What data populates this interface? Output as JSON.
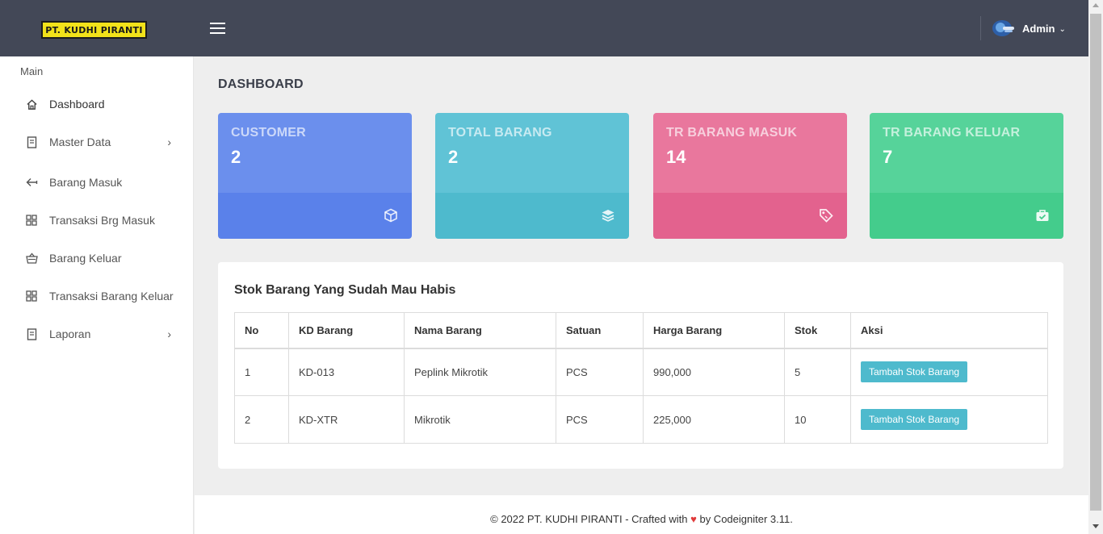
{
  "header": {
    "logo_text": "PT. KUDHI PIRANTI",
    "user_label": "Admin",
    "caret": "⌄"
  },
  "sidebar": {
    "section_label": "Main",
    "items": [
      {
        "label": "Dashboard",
        "icon": "home-icon"
      },
      {
        "label": "Master Data",
        "icon": "document-icon",
        "submenu": true
      },
      {
        "label": "Barang Masuk",
        "icon": "arrow-left-icon"
      },
      {
        "label": "Transaksi Brg Masuk",
        "icon": "grid-icon"
      },
      {
        "label": "Barang Keluar",
        "icon": "basket-icon"
      },
      {
        "label": "Transaksi Barang Keluar",
        "icon": "grid-icon"
      },
      {
        "label": "Laporan",
        "icon": "document-icon",
        "submenu": true
      }
    ],
    "chevron": "›"
  },
  "page": {
    "title": "DASHBOARD"
  },
  "cards": [
    {
      "title": "CUSTOMER",
      "value": "2",
      "icon": "cube-icon",
      "color": "#6b8fed"
    },
    {
      "title": "TOTAL BARANG",
      "value": "2",
      "icon": "layers-icon",
      "color": "#60c3d6"
    },
    {
      "title": "TR BARANG MASUK",
      "value": "14",
      "icon": "tag-icon",
      "color": "#e9779d"
    },
    {
      "title": "TR BARANG KELUAR",
      "value": "7",
      "icon": "briefcase-check-icon",
      "color": "#56d39a"
    }
  ],
  "stock_panel": {
    "title": "Stok Barang Yang Sudah Mau Habis",
    "columns": [
      "No",
      "KD Barang",
      "Nama Barang",
      "Satuan",
      "Harga Barang",
      "Stok",
      "Aksi"
    ],
    "rows": [
      {
        "no": "1",
        "kd": "KD-013",
        "nama": "Peplink Mikrotik",
        "satuan": "PCS",
        "harga": "990,000",
        "stok": "5",
        "aksi": "Tambah Stok Barang"
      },
      {
        "no": "2",
        "kd": "KD-XTR",
        "nama": "Mikrotik",
        "satuan": "PCS",
        "harga": "225,000",
        "stok": "10",
        "aksi": "Tambah Stok Barang"
      }
    ]
  },
  "footer": {
    "text_before": "© 2022 PT. KUDHI PIRANTI - Crafted with",
    "heart": "♥",
    "text_after": "by Codeigniter 3.11."
  }
}
